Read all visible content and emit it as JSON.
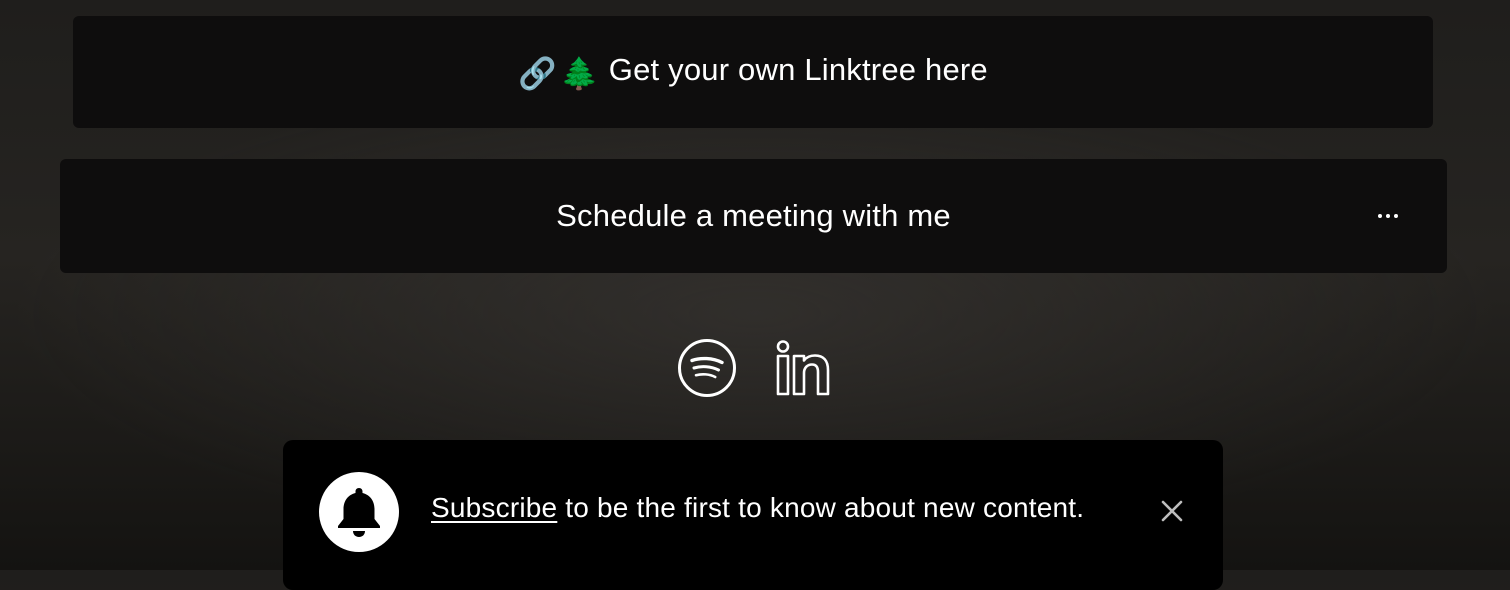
{
  "links": [
    {
      "emoji": [
        "🔗",
        "🌲"
      ],
      "label": "Get your own Linktree here"
    },
    {
      "label": "Schedule a meeting with me",
      "more_icon": "more-horizontal-icon"
    }
  ],
  "socials": [
    {
      "name": "Spotify",
      "icon": "spotify-icon"
    },
    {
      "name": "LinkedIn",
      "icon": "linkedin-icon"
    }
  ],
  "subscribe_banner": {
    "link_text": "Subscribe",
    "text": " to be the first to know about new content.",
    "bell_icon": "bell-icon",
    "close_icon": "close-icon"
  },
  "colors": {
    "card_background": "#0e0d0d",
    "banner_background": "#000000",
    "text": "#ffffff"
  }
}
